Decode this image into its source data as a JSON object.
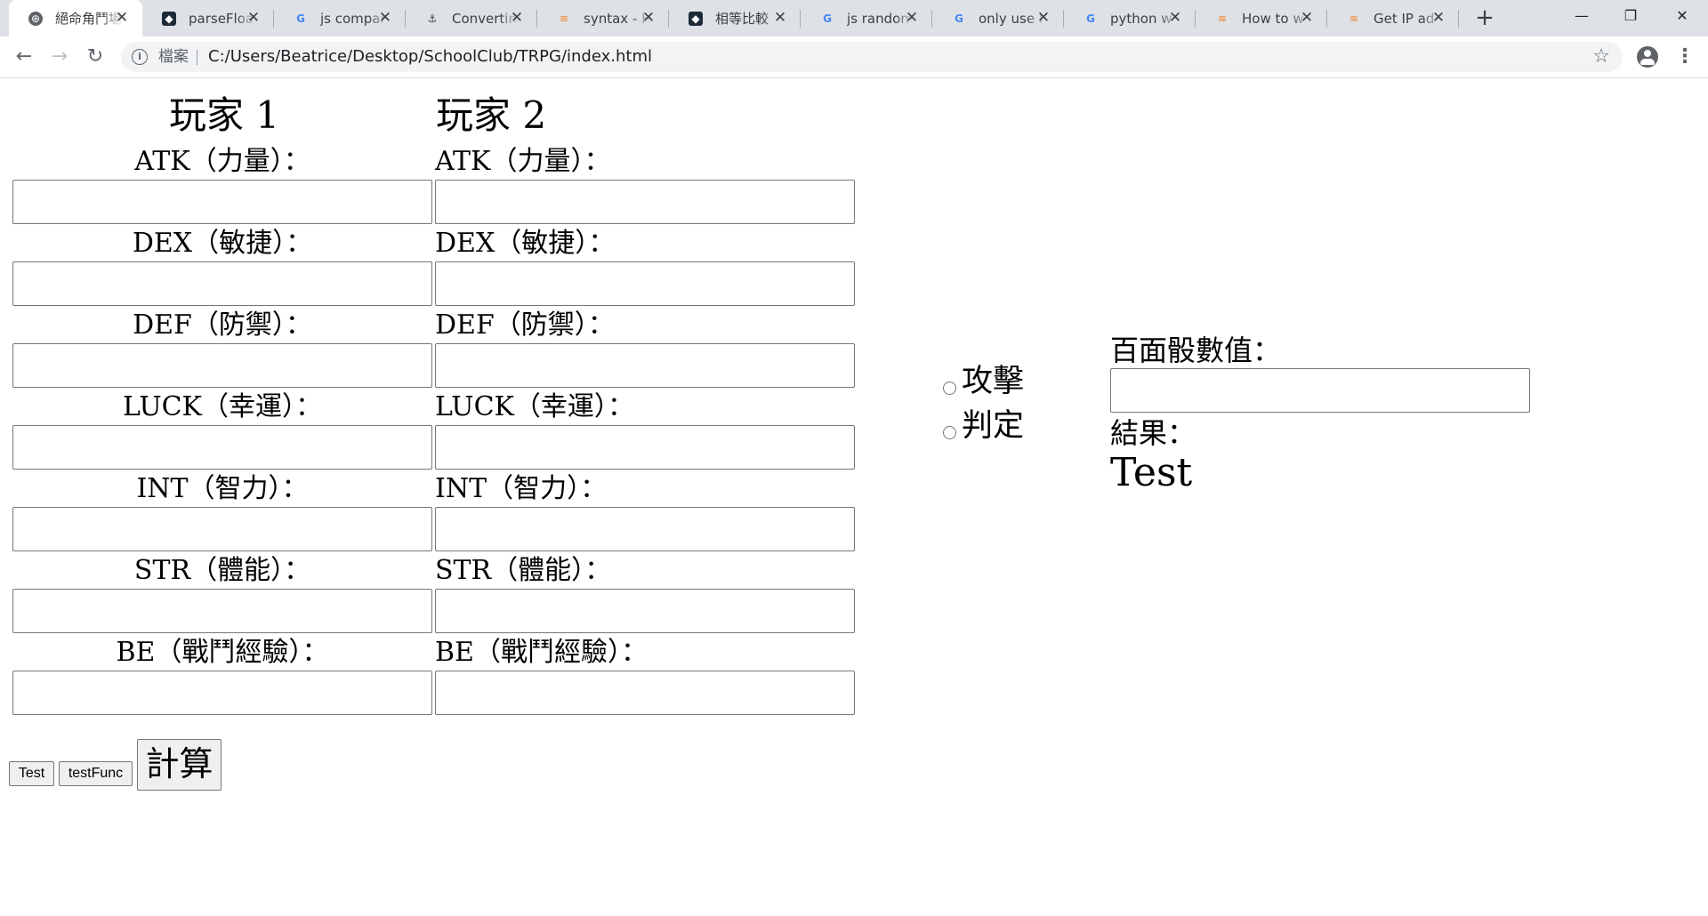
{
  "browser": {
    "tabs": [
      {
        "title": "絕命角鬥場",
        "favicon": "globe-icon",
        "active": true
      },
      {
        "title": "parseFloat",
        "favicon": "tw-icon",
        "active": false
      },
      {
        "title": "js compare",
        "favicon": "google-icon",
        "active": false
      },
      {
        "title": "Converting",
        "favicon": "anchor-icon",
        "active": false
      },
      {
        "title": "syntax - H",
        "favicon": "stackoverflow-icon",
        "active": false
      },
      {
        "title": "相等比較",
        "favicon": "tw-icon",
        "active": false
      },
      {
        "title": "js random",
        "favicon": "google-icon",
        "active": false
      },
      {
        "title": "only use l",
        "favicon": "google-icon",
        "active": false
      },
      {
        "title": "python w",
        "favicon": "google-icon",
        "active": false
      },
      {
        "title": "How to w",
        "favicon": "stackoverflow-icon",
        "active": false
      },
      {
        "title": "Get IP ad",
        "favicon": "stackoverflow-icon",
        "active": false
      }
    ],
    "scheme_label": "檔案",
    "url": "C:/Users/Beatrice/Desktop/SchoolClub/TRPG/index.html"
  },
  "player1": {
    "title": "玩家 1",
    "stats": [
      {
        "label": "ATK（力量）：",
        "value": ""
      },
      {
        "label": "DEX（敏捷）：",
        "value": ""
      },
      {
        "label": "DEF（防禦）：",
        "value": ""
      },
      {
        "label": "LUCK（幸運）：",
        "value": ""
      },
      {
        "label": "INT（智力）：",
        "value": ""
      },
      {
        "label": "STR（體能）：",
        "value": ""
      },
      {
        "label": "BE（戰鬥經驗）：",
        "value": ""
      }
    ]
  },
  "player2": {
    "title": "玩家 2",
    "stats": [
      {
        "label": "ATK（力量）：",
        "value": ""
      },
      {
        "label": "DEX（敏捷）：",
        "value": ""
      },
      {
        "label": "DEF（防禦）：",
        "value": ""
      },
      {
        "label": "LUCK（幸運）：",
        "value": ""
      },
      {
        "label": "INT（智力）：",
        "value": ""
      },
      {
        "label": "STR（體能）：",
        "value": ""
      },
      {
        "label": "BE（戰鬥經驗）：",
        "value": ""
      }
    ]
  },
  "actions": {
    "test_label": "Test",
    "testfunc_label": "testFunc",
    "calc_label": "計算"
  },
  "mode": {
    "options": [
      {
        "label": "攻擊",
        "checked": false
      },
      {
        "label": "判定",
        "checked": false
      }
    ]
  },
  "dice": {
    "label": "百面骰數值：",
    "value": "",
    "result_label": "結果：",
    "result_value": "Test"
  }
}
